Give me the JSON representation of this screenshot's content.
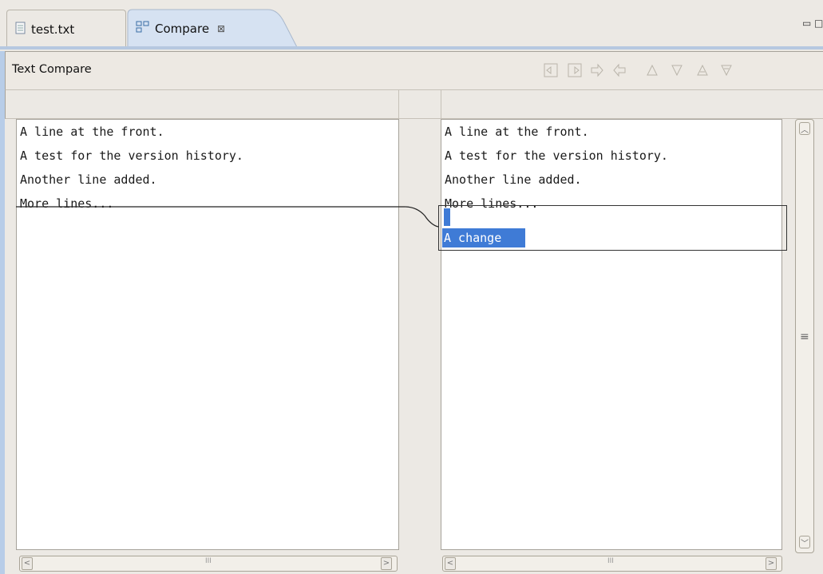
{
  "tabs": [
    {
      "label": "test.txt",
      "icon": "text-file-icon"
    },
    {
      "label": "Compare",
      "icon": "compare-icon",
      "close": "⊠"
    }
  ],
  "window_controls": {
    "minimize": "▭",
    "maximize": "□"
  },
  "header": {
    "title": "Text Compare",
    "toolbar_icons": [
      "copy-all-left-to-right-icon",
      "copy-all-right-to-left-icon",
      "copy-current-right-icon",
      "copy-current-left-icon",
      "next-difference-icon",
      "previous-difference-icon",
      "next-change-icon",
      "previous-change-icon"
    ]
  },
  "left_pane": {
    "lines": [
      "A line at the front.",
      "A test for the version history.",
      "Another line added.",
      "More lines..."
    ]
  },
  "right_pane": {
    "lines": [
      "A line at the front.",
      "A test for the version history.",
      "Another line added.",
      "More lines..."
    ],
    "selected_text": "A change"
  },
  "scrollbars": {
    "left_arrow": "<",
    "right_arrow": ">",
    "up_arrow": "︿",
    "down_arrow": "﹀",
    "grip": "III",
    "vgrip": "≡"
  },
  "colors": {
    "selection": "#3f7bd6",
    "tab_accent": "#b6c8e0"
  }
}
